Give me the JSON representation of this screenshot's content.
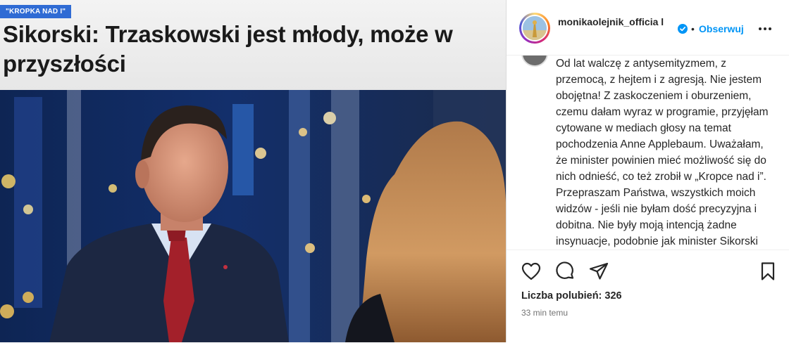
{
  "post_media": {
    "tag": "\"KROPKA NAD I\"",
    "headline": "Sikorski: Trzaskowski jest młody, może w przyszłości"
  },
  "header": {
    "username": "monikaolejnik_officia l",
    "separator": "•",
    "follow_label": "Obserwuj"
  },
  "caption": {
    "text": "Od lat walczę z antysemityzmem, z przemocą, z hejtem i z agresją. Nie jestem obojętna! Z zaskoczeniem i oburzeniem, czemu dałam wyraz w programie, przyjęłam cytowane w mediach głosy na temat pochodzenia Anne Applebaum. Uważałam, że minister powinien mieć możliwość się do nich odnieść, co też zrobił w „Kropce nad i”. Przepraszam Państwa, wszystkich moich widzów - jeśli nie byłam dość precyzyjna i dobitna. Nie były moją intencją żadne insynuacje, podobnie jak minister Sikorski uważam, że"
  },
  "actions": {
    "icons": [
      "heart-icon",
      "comment-icon",
      "share-icon",
      "bookmark-icon"
    ],
    "likes_label": "Liczba polubień: 326",
    "time_label": "33 min temu"
  },
  "colors": {
    "accent": "#0095f6",
    "tag_bg": "#2f6bd4",
    "tie": "#a3202a"
  }
}
